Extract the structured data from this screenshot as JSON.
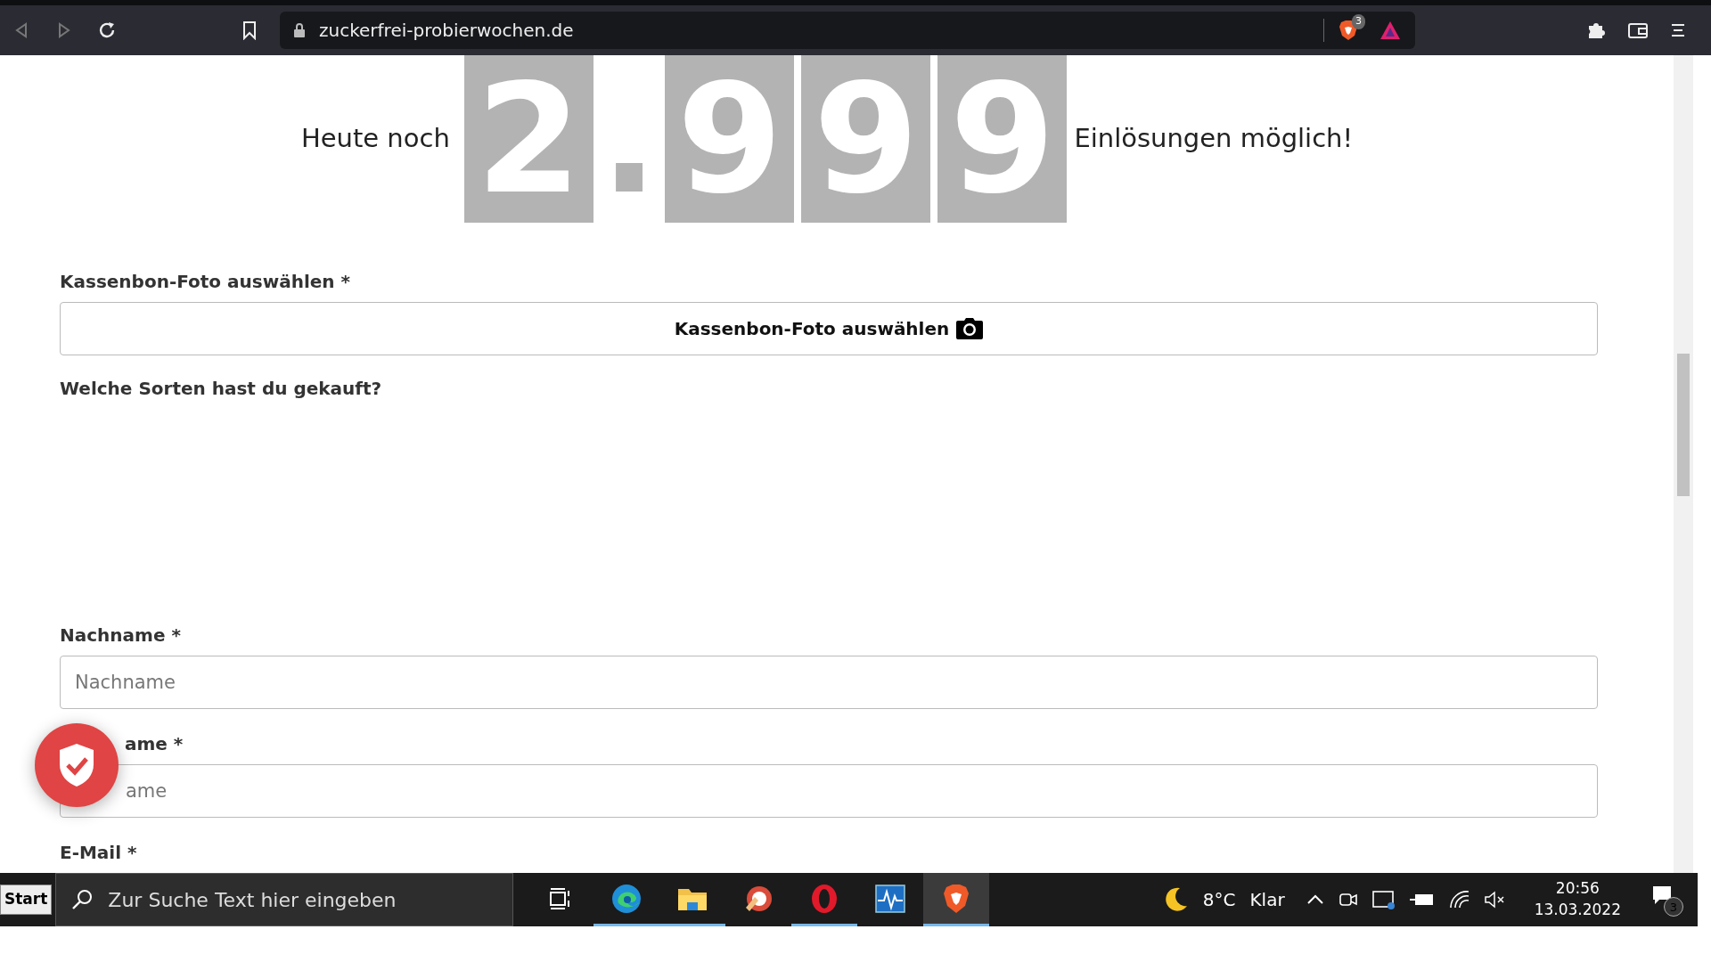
{
  "browser": {
    "url": "zuckerfrei-probierwochen.de",
    "shields_count": "3"
  },
  "counter": {
    "prefix": "Heute noch",
    "digits": [
      {
        "kind": "digit",
        "text": "2"
      },
      {
        "kind": "separator",
        "text": "."
      },
      {
        "kind": "digit",
        "text": "9"
      },
      {
        "kind": "digit",
        "text": "9"
      },
      {
        "kind": "digit",
        "text": "9"
      }
    ],
    "suffix": "Einlösungen möglich!"
  },
  "form": {
    "fields": [
      {
        "kind": "file",
        "label": "Kassenbon-Foto auswählen *",
        "button": "Kassenbon-Foto auswählen"
      },
      {
        "kind": "section",
        "label": "Welche Sorten hast du gekauft?"
      },
      {
        "kind": "text",
        "label": "Nachname *",
        "placeholder": "Nachname"
      },
      {
        "kind": "text",
        "label": "ame *",
        "placeholder": "ame",
        "covered": true
      },
      {
        "kind": "text",
        "label": "E-Mail *"
      }
    ]
  },
  "taskbar": {
    "start": "Start",
    "search_placeholder": "Zur Suche Text hier eingeben",
    "apps": [
      {
        "kind": "taskview",
        "running": false,
        "active": false
      },
      {
        "kind": "edge",
        "running": true,
        "active": false
      },
      {
        "kind": "explorer",
        "running": true,
        "active": false
      },
      {
        "kind": "cleaner",
        "running": false,
        "active": false
      },
      {
        "kind": "opera",
        "running": true,
        "active": false
      },
      {
        "kind": "monitor",
        "running": false,
        "active": false
      },
      {
        "kind": "brave",
        "running": true,
        "active": true
      }
    ],
    "temperature": "8°C",
    "condition": "Klar",
    "time": "20:56",
    "date": "13.03.2022",
    "notifications": "3"
  }
}
